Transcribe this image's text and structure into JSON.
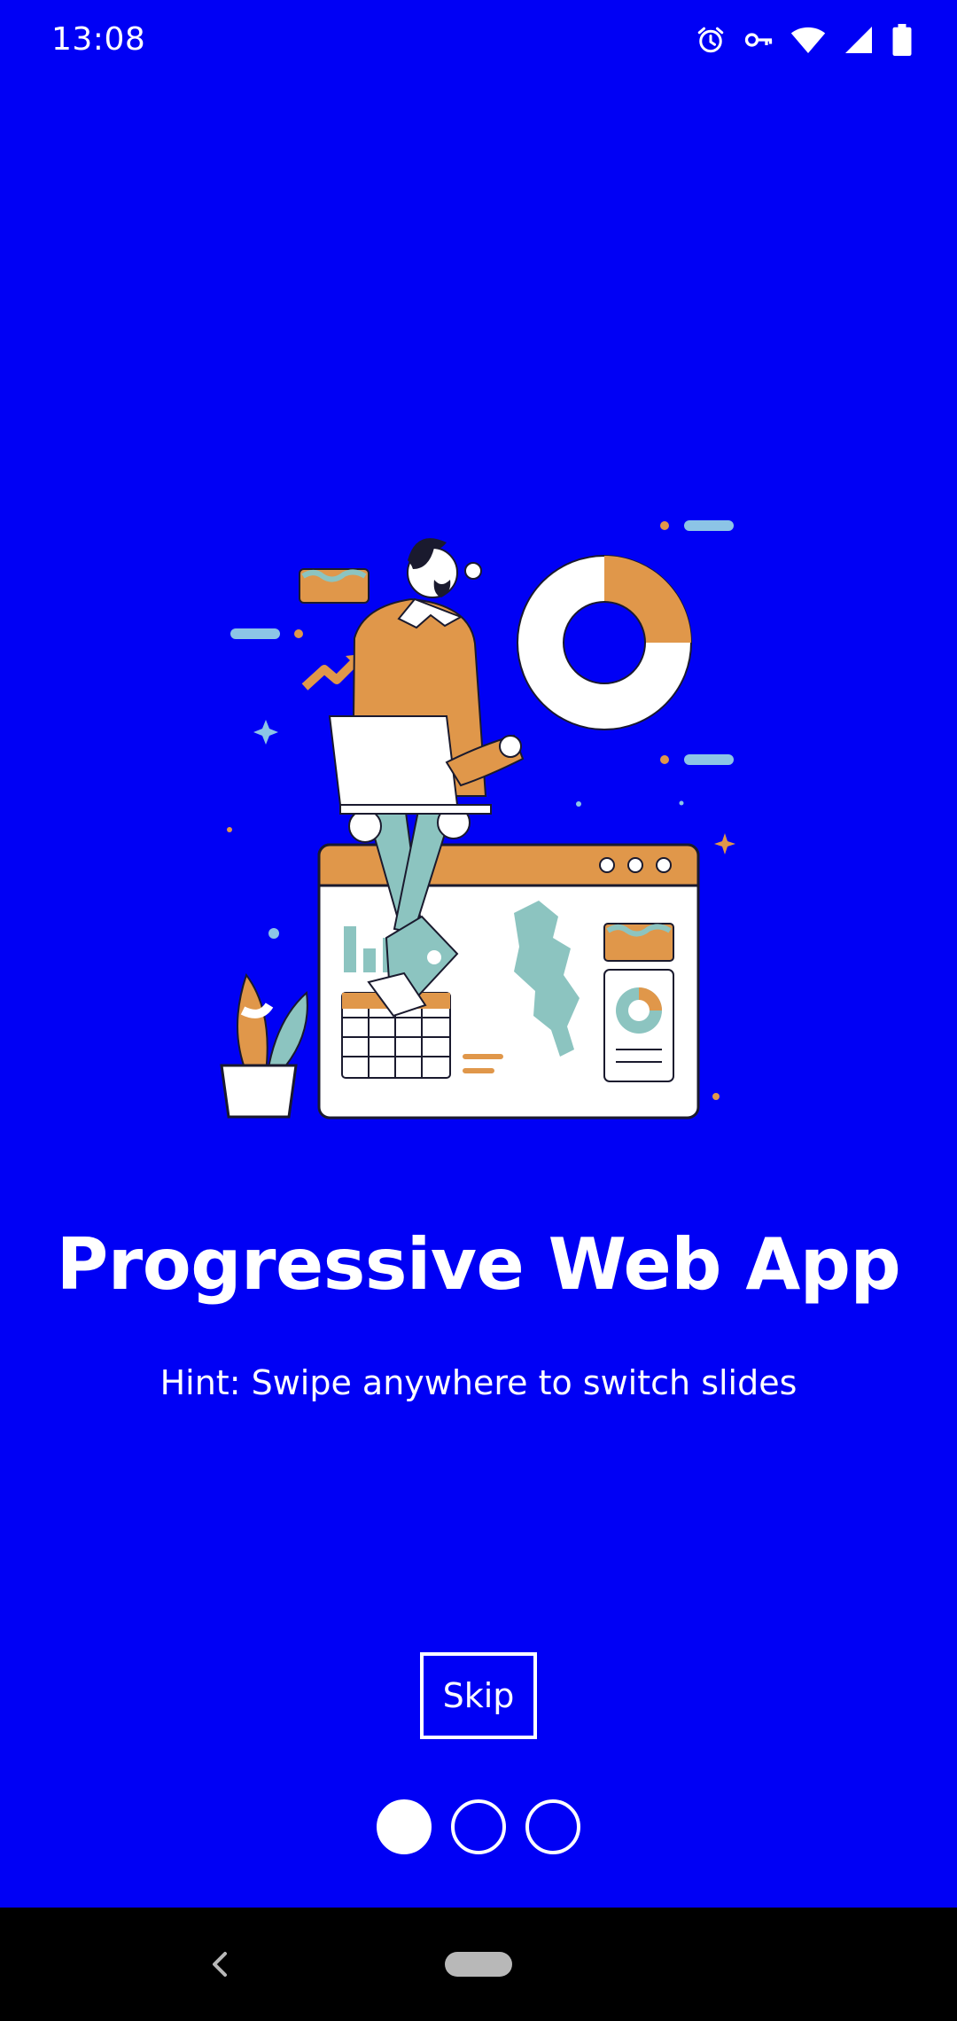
{
  "status_bar": {
    "time": "13:08",
    "icons": [
      "alarm-icon",
      "vpn-key-icon",
      "wifi-icon",
      "signal-icon",
      "battery-icon"
    ]
  },
  "slide": {
    "title": "Progressive Web App",
    "hint": "Hint: Swipe anywhere to switch slides"
  },
  "skip_button": {
    "label": "Skip"
  },
  "pager": {
    "total": 3,
    "active_index": 0
  },
  "colors": {
    "background": "#0000f5",
    "accent_orange": "#e0974a",
    "accent_teal": "#8cc4c0",
    "text": "#ffffff"
  }
}
